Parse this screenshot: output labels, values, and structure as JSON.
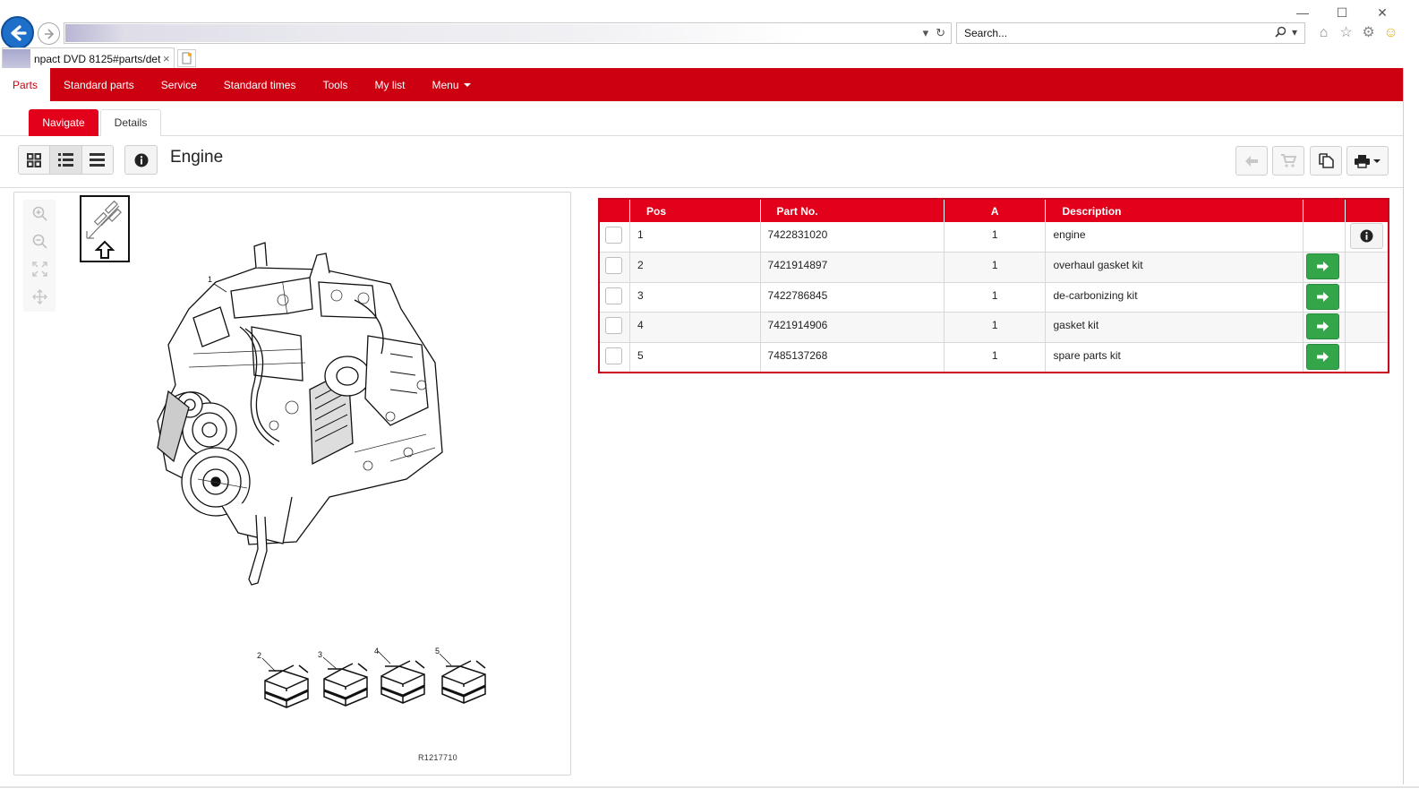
{
  "browser": {
    "tab_title": "npact DVD 8125#parts/det...",
    "tab_close": "×",
    "search_placeholder": "Search...",
    "window_controls": {
      "minimize": "—",
      "maximize": "☐",
      "close": "✕"
    }
  },
  "nav": {
    "items": [
      {
        "label": "Parts",
        "active": true
      },
      {
        "label": "Standard parts"
      },
      {
        "label": "Service"
      },
      {
        "label": "Standard times"
      },
      {
        "label": "Tools"
      },
      {
        "label": "My list"
      },
      {
        "label": "Menu",
        "dropdown": true
      }
    ]
  },
  "subtabs": {
    "navigate": "Navigate",
    "details": "Details"
  },
  "toolbar": {
    "title": "Engine"
  },
  "drawing": {
    "id": "R1217710",
    "callouts": [
      "1",
      "2",
      "3",
      "4",
      "5"
    ]
  },
  "table": {
    "headers": {
      "pos": "Pos",
      "part_no": "Part No.",
      "qty": "A",
      "description": "Description"
    },
    "rows": [
      {
        "pos": "1",
        "part_no": "7422831020",
        "qty": "1",
        "description": "engine",
        "action": "info"
      },
      {
        "pos": "2",
        "part_no": "7421914897",
        "qty": "1",
        "description": "overhaul gasket kit",
        "action": "go"
      },
      {
        "pos": "3",
        "part_no": "7422786845",
        "qty": "1",
        "description": "de-carbonizing kit",
        "action": "go"
      },
      {
        "pos": "4",
        "part_no": "7421914906",
        "qty": "1",
        "description": "gasket kit",
        "action": "go"
      },
      {
        "pos": "5",
        "part_no": "7485137268",
        "qty": "1",
        "description": "spare parts kit",
        "action": "go"
      }
    ]
  },
  "colors": {
    "brand_red": "#cc0010",
    "accent_red": "#e2001a",
    "go_green": "#33a64a",
    "ie_blue": "#1e6fc9"
  },
  "icons": [
    "back-arrow-icon",
    "forward-arrow-icon",
    "refresh-icon",
    "search-icon",
    "home-icon",
    "star-icon",
    "gear-icon",
    "smiley-icon",
    "grid-view-icon",
    "list-view-icon",
    "detail-view-icon",
    "info-icon",
    "back-icon",
    "cart-icon",
    "copy-icon",
    "print-icon",
    "zoom-in-icon",
    "zoom-out-icon",
    "fit-icon",
    "pan-icon",
    "arrow-right-icon"
  ]
}
